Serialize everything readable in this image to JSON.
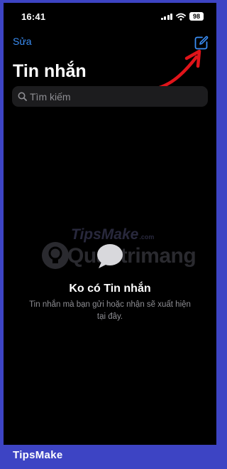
{
  "status_bar": {
    "time": "16:41",
    "battery": "98"
  },
  "nav": {
    "edit_label": "Sửa",
    "compose_icon": "compose-icon"
  },
  "page": {
    "title": "Tin nhắn"
  },
  "search": {
    "placeholder": "Tìm kiếm",
    "value": ""
  },
  "empty_state": {
    "title": "Ko có Tin nhắn",
    "description": "Tin nhắn mà bạn gửi hoặc nhận sẽ xuất hiện tại đây.",
    "icon": "message-bubble-icon"
  },
  "watermark": {
    "top_text": "TipsMake",
    "top_suffix": ".com",
    "main_text": "Quantrimang"
  },
  "footer": {
    "brand": "TipsMake"
  },
  "colors": {
    "accent": "#3a8ef6",
    "frame_border": "#3d44c4",
    "annotation_arrow": "#e0141a"
  }
}
